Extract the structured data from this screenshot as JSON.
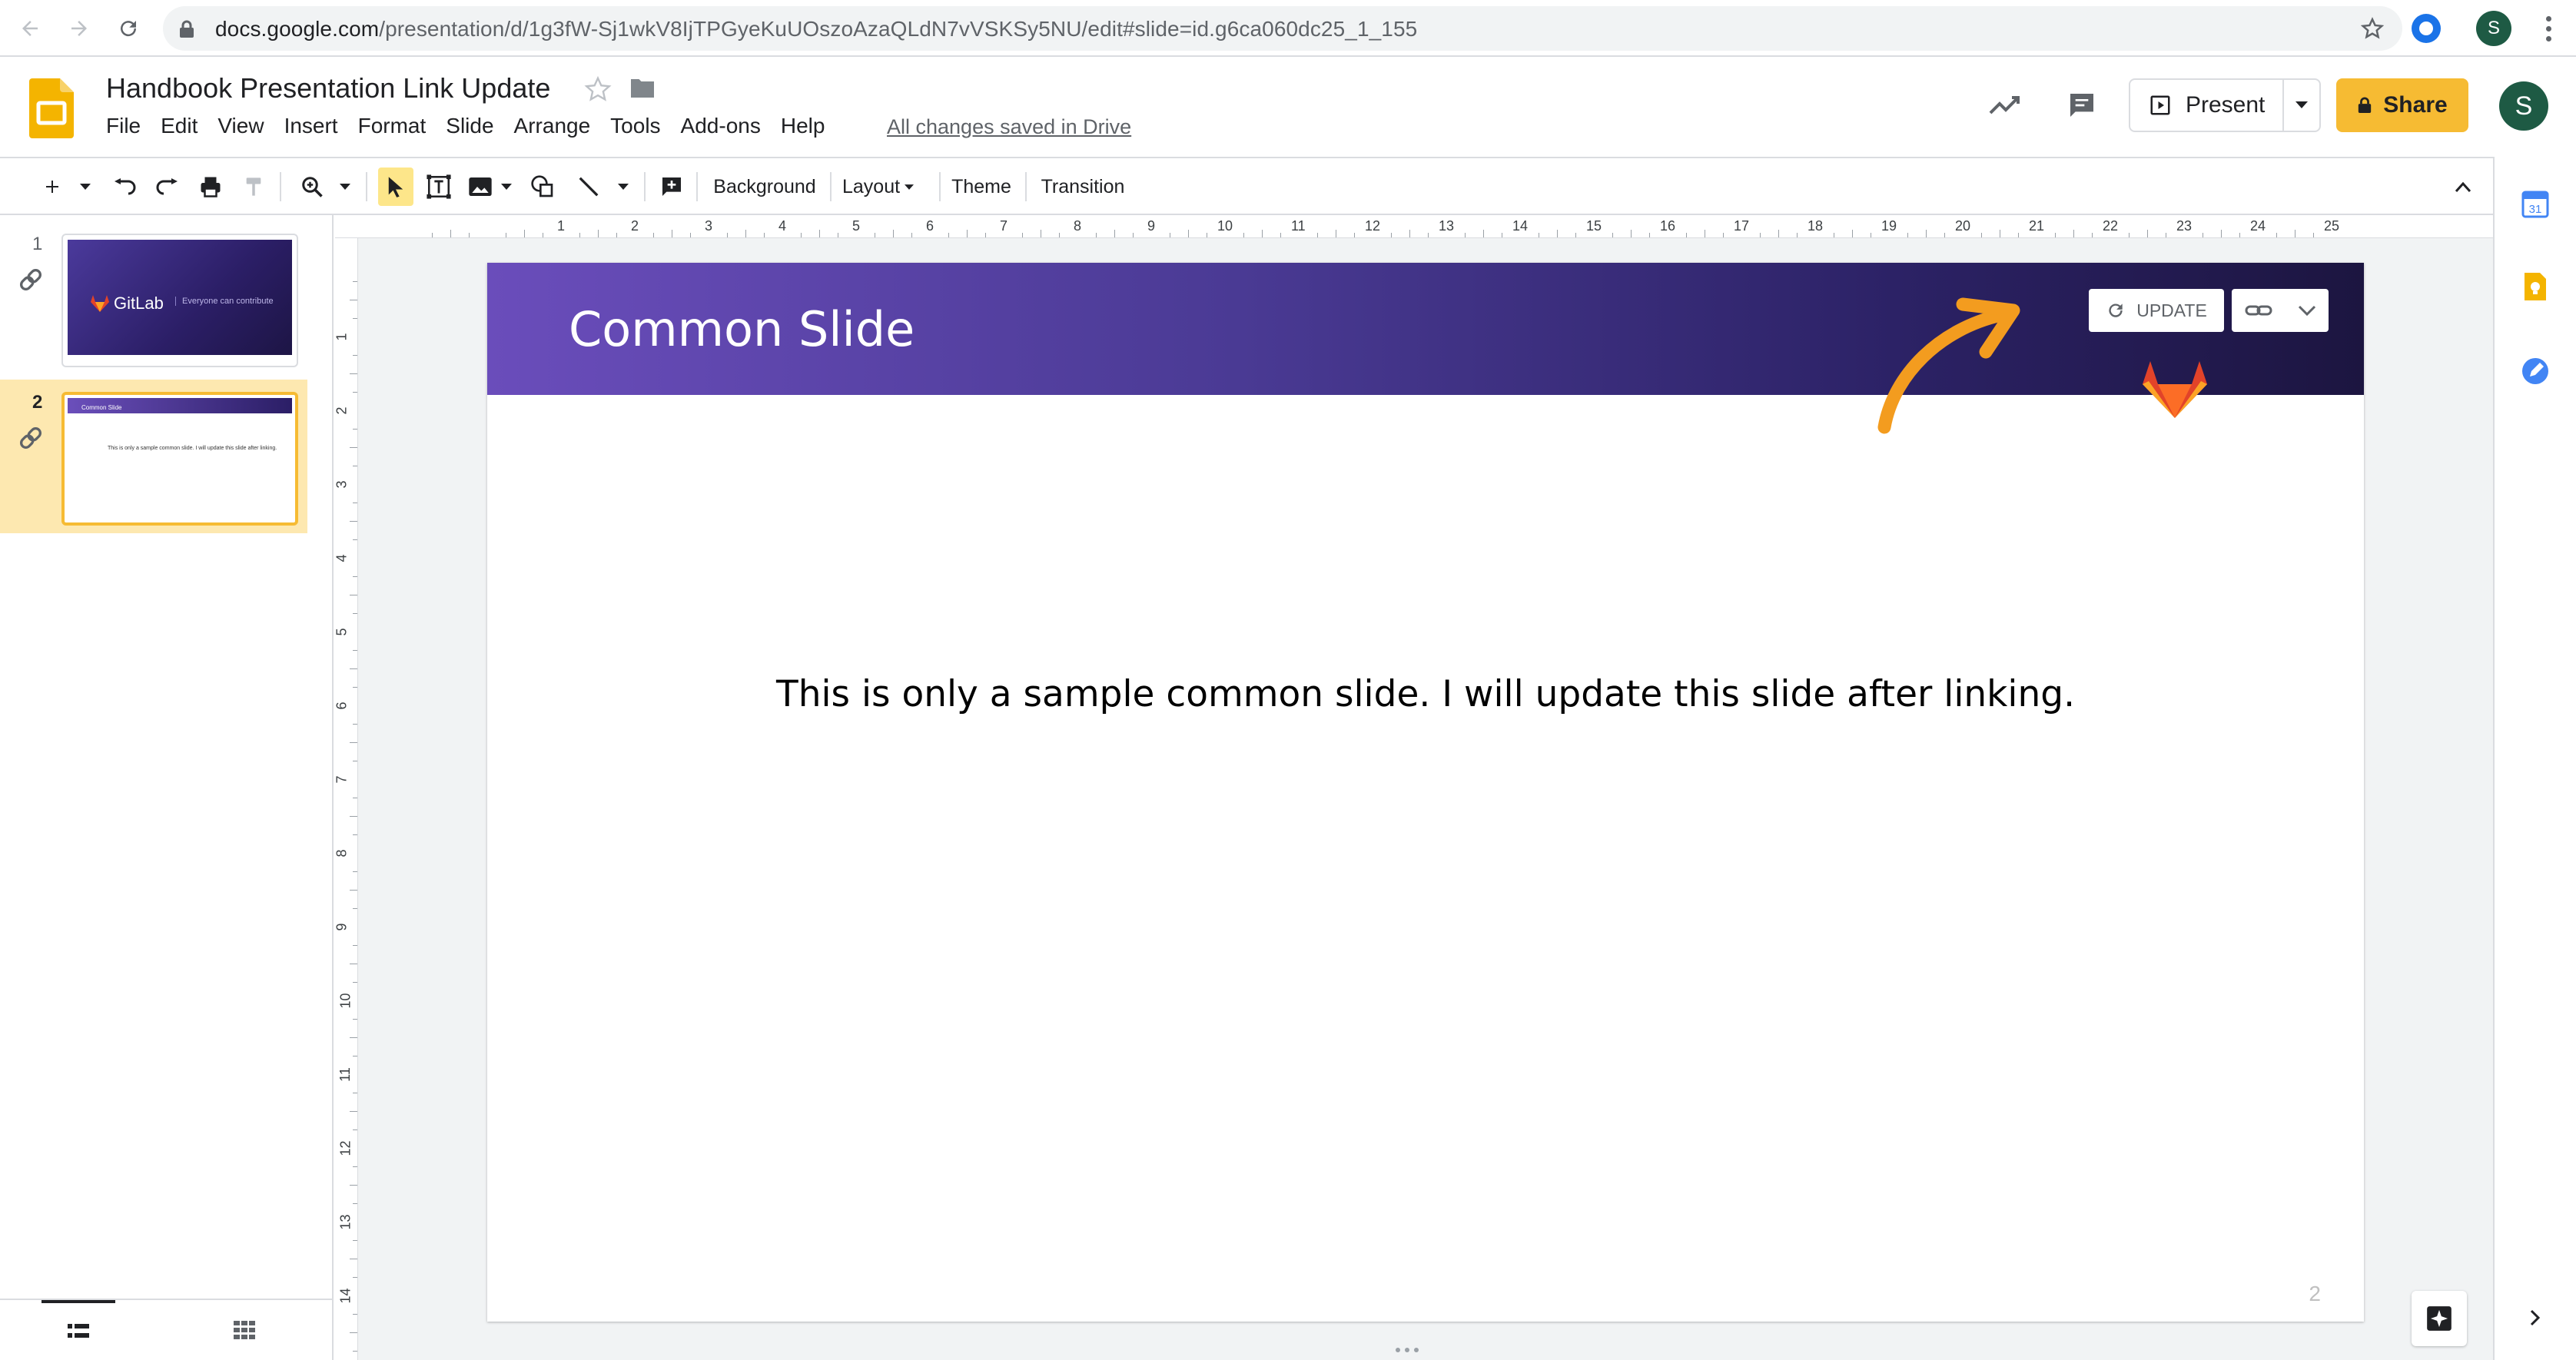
{
  "browser": {
    "url_domain": "docs.google.com",
    "url_path": "/presentation/d/1g3fW-Sj1wkV8IjTPGyeKuUOszoAzaQLdN7vVSKSy5NU/edit#slide=id.g6ca060dc25_1_155",
    "profile_initial": "S"
  },
  "document": {
    "title": "Handbook Presentation Link Update",
    "saved_status": "All changes saved in Drive",
    "present_label": "Present",
    "share_label": "Share",
    "user_initial": "S"
  },
  "menu": [
    "File",
    "Edit",
    "View",
    "Insert",
    "Format",
    "Slide",
    "Arrange",
    "Tools",
    "Add-ons",
    "Help"
  ],
  "toolbar": {
    "background_label": "Background",
    "layout_label": "Layout",
    "theme_label": "Theme",
    "transition_label": "Transition"
  },
  "filmstrip": {
    "slides": [
      {
        "number": "1",
        "logo_text": "GitLab",
        "tagline": "Everyone can contribute"
      },
      {
        "number": "2",
        "title": "Common Slide",
        "body": "This is only a sample common slide. I will update this slide after linking."
      }
    ]
  },
  "rulers": {
    "top": [
      "1",
      "2",
      "3",
      "4",
      "5",
      "6",
      "7",
      "8",
      "9",
      "10",
      "11",
      "12",
      "13",
      "14",
      "15",
      "16",
      "17",
      "18",
      "19",
      "20",
      "21",
      "22",
      "23",
      "24",
      "25"
    ],
    "left": [
      "1",
      "2",
      "3",
      "4",
      "5",
      "6",
      "7",
      "8",
      "9",
      "10",
      "11",
      "12",
      "13",
      "14"
    ]
  },
  "slide": {
    "title": "Common Slide",
    "body": "This is only a sample common slide. I will update this slide after linking.",
    "update_label": "UPDATE",
    "page_number": "2"
  },
  "colors": {
    "accent_yellow": "#f6bb33",
    "band_start": "#6a4dbb",
    "band_end": "#1c1540",
    "annotation_arrow": "#f39c1f",
    "gitlab_orange": "#e24329"
  },
  "icons": {
    "back": "arrow-left-icon",
    "forward": "arrow-right-icon",
    "reload": "reload-icon",
    "lock": "lock-icon",
    "bookmark": "star-icon",
    "activity": "trending-up-icon",
    "comments": "comment-icon",
    "present": "present-icon",
    "link": "link-icon"
  }
}
